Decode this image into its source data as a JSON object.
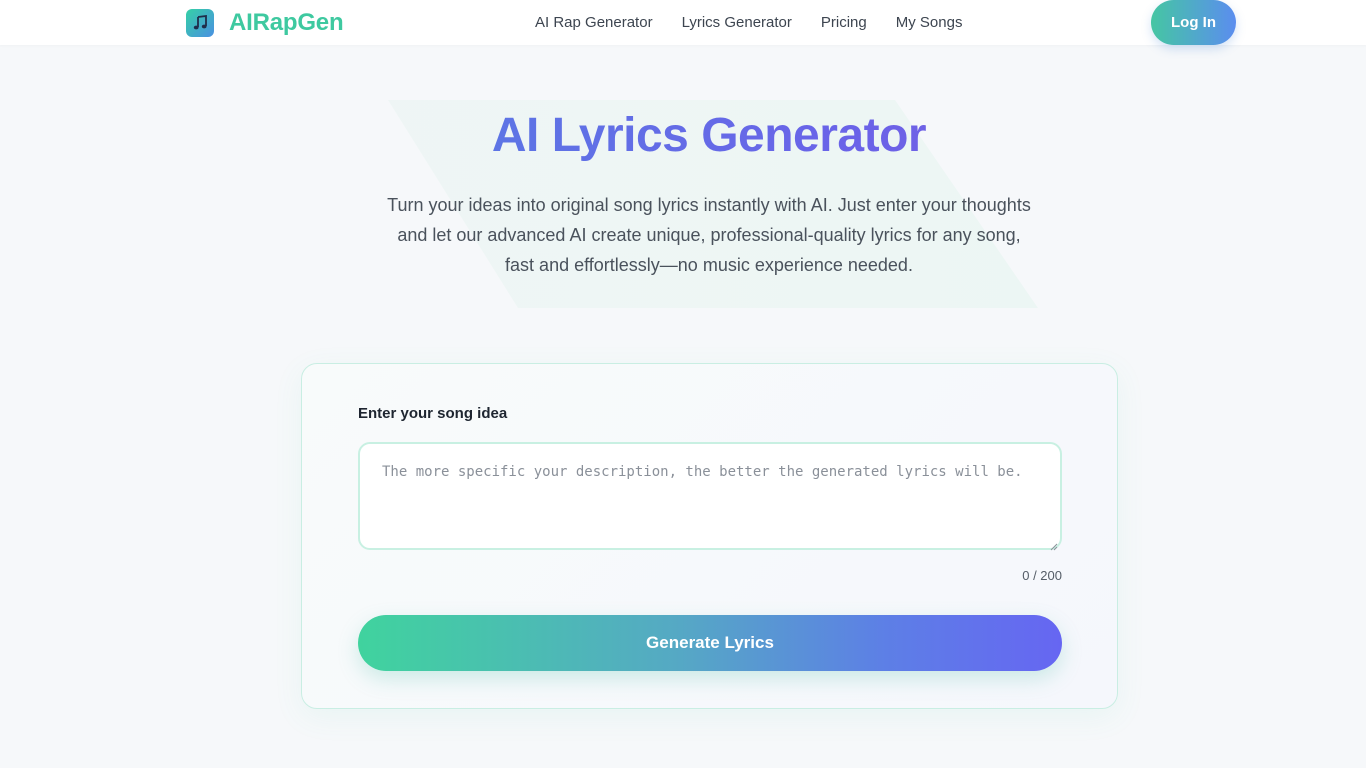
{
  "header": {
    "logo_text": "AIRapGen",
    "nav": [
      {
        "label": "AI Rap Generator"
      },
      {
        "label": "Lyrics Generator"
      },
      {
        "label": "Pricing"
      },
      {
        "label": "My Songs"
      }
    ],
    "login_label": "Log In"
  },
  "hero": {
    "title": "AI Lyrics Generator",
    "subtitle": "Turn your ideas into original song lyrics instantly with AI. Just enter your thoughts and let our advanced AI create unique, professional-quality lyrics for any song, fast and effortlessly—no music experience needed."
  },
  "form": {
    "label": "Enter your song idea",
    "placeholder": "The more specific your description, the better the generated lyrics will be.",
    "value": "",
    "counter": "0 / 200",
    "submit_label": "Generate Lyrics"
  },
  "colors": {
    "brand": "#3ec9a0",
    "accent_start": "#40d39e",
    "accent_end": "#6666f2"
  }
}
